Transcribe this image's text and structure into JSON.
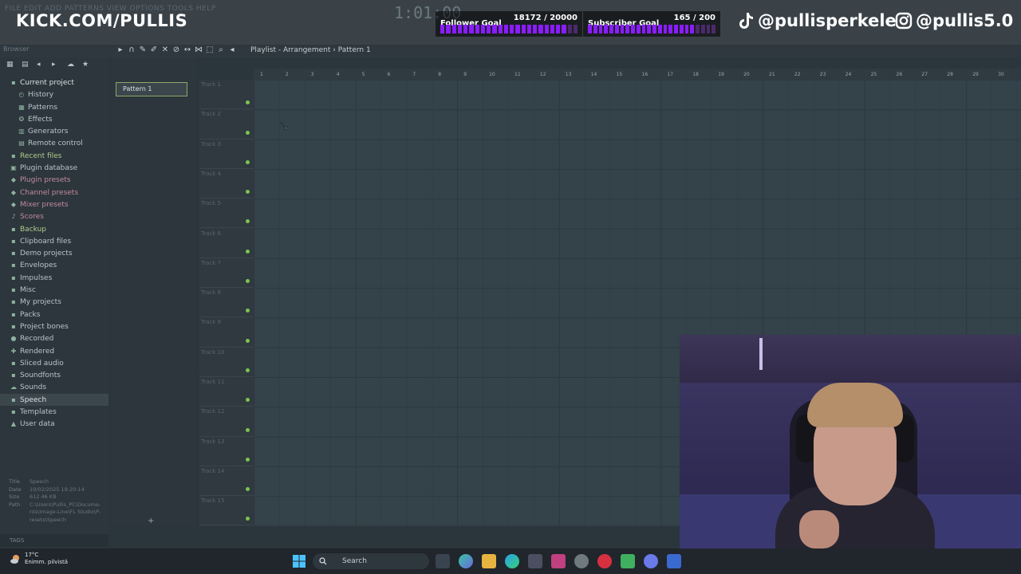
{
  "overlay": {
    "channel": "KICK.COM/PULLIS",
    "follower_goal": {
      "label": "Follower Goal",
      "value": "18172 / 20000",
      "progress": 0.9086
    },
    "subscriber_goal": {
      "label": "Subscriber Goal",
      "value": "165 / 200",
      "progress": 0.825
    },
    "tiktok_handle": "@pullisperkele",
    "instagram_handle": "@pullis5.0",
    "bar_color": "#8a1cff"
  },
  "app": {
    "background_menu": "FILE EDIT ADD PATTERNS VIEW OPTIONS TOOLS HELP",
    "background_time": "1:01:00",
    "browser_tab": "Browser",
    "playlist": {
      "title": "Playlist - Arrangement",
      "separator": "›",
      "pattern": "Pattern 1",
      "pattern_item": "Pattern 1",
      "ruler": [
        "1",
        "2",
        "3",
        "4",
        "5",
        "6",
        "7",
        "8",
        "9",
        "10",
        "11",
        "12",
        "13",
        "14",
        "15",
        "16",
        "17",
        "18",
        "19",
        "20",
        "21",
        "22",
        "23",
        "24",
        "25",
        "26",
        "27",
        "28",
        "29",
        "30"
      ],
      "tracks": [
        "Track 1",
        "Track 2",
        "Track 3",
        "Track 4",
        "Track 5",
        "Track 6",
        "Track 7",
        "Track 8",
        "Track 9",
        "Track 10",
        "Track 11",
        "Track 12",
        "Track 13",
        "Track 14",
        "Track 15"
      ]
    },
    "browser": {
      "items": [
        {
          "label": "Current project",
          "style": "hdr",
          "icon": "folder-icon",
          "indent": 0
        },
        {
          "label": "History",
          "style": "normal",
          "icon": "history-icon",
          "indent": 1
        },
        {
          "label": "Patterns",
          "style": "normal",
          "icon": "patterns-icon",
          "indent": 1
        },
        {
          "label": "Effects",
          "style": "normal",
          "icon": "effects-icon",
          "indent": 1
        },
        {
          "label": "Generators",
          "style": "normal",
          "icon": "generators-icon",
          "indent": 1
        },
        {
          "label": "Remote control",
          "style": "normal",
          "icon": "remote-icon",
          "indent": 1
        },
        {
          "label": "Recent files",
          "style": "green",
          "icon": "folder-icon",
          "indent": 0
        },
        {
          "label": "Plugin database",
          "style": "normal",
          "icon": "database-icon",
          "indent": 0
        },
        {
          "label": "Plugin presets",
          "style": "pink",
          "icon": "preset-icon",
          "indent": 0
        },
        {
          "label": "Channel presets",
          "style": "pink",
          "icon": "preset-icon",
          "indent": 0
        },
        {
          "label": "Mixer presets",
          "style": "pink",
          "icon": "preset-icon",
          "indent": 0
        },
        {
          "label": "Scores",
          "style": "pink",
          "icon": "score-icon",
          "indent": 0
        },
        {
          "label": "Backup",
          "style": "green",
          "icon": "folder-icon",
          "indent": 0
        },
        {
          "label": "Clipboard files",
          "style": "normal",
          "icon": "folder-icon",
          "indent": 0
        },
        {
          "label": "Demo projects",
          "style": "normal",
          "icon": "folder-icon",
          "indent": 0
        },
        {
          "label": "Envelopes",
          "style": "normal",
          "icon": "folder-icon",
          "indent": 0
        },
        {
          "label": "Impulses",
          "style": "normal",
          "icon": "folder-icon",
          "indent": 0
        },
        {
          "label": "Misc",
          "style": "normal",
          "icon": "folder-icon",
          "indent": 0
        },
        {
          "label": "My projects",
          "style": "normal",
          "icon": "folder-icon",
          "indent": 0
        },
        {
          "label": "Packs",
          "style": "normal",
          "icon": "folder-icon",
          "indent": 0
        },
        {
          "label": "Project bones",
          "style": "normal",
          "icon": "folder-icon",
          "indent": 0
        },
        {
          "label": "Recorded",
          "style": "normal",
          "icon": "recorded-icon",
          "indent": 0
        },
        {
          "label": "Rendered",
          "style": "normal",
          "icon": "rendered-icon",
          "indent": 0
        },
        {
          "label": "Sliced audio",
          "style": "normal",
          "icon": "folder-icon",
          "indent": 0
        },
        {
          "label": "Soundfonts",
          "style": "normal",
          "icon": "folder-icon",
          "indent": 0
        },
        {
          "label": "Sounds",
          "style": "normal",
          "icon": "cloud-icon",
          "indent": 0
        },
        {
          "label": "Speech",
          "style": "hdr",
          "icon": "folder-icon",
          "indent": 0,
          "selected": true
        },
        {
          "label": "Templates",
          "style": "normal",
          "icon": "folder-icon",
          "indent": 0
        },
        {
          "label": "User data",
          "style": "normal",
          "icon": "user-icon",
          "indent": 0
        }
      ],
      "fileinfo": {
        "title_k": "Title",
        "title_v": "Speech",
        "date_k": "Date",
        "date_v": "19/02/2025 19:20:14",
        "size_k": "Size",
        "size_v": "612.46 KB",
        "path_k": "Path",
        "path_v1": "C:\\Users\\Pullis_PC\\Docume-",
        "path_v2": "nts\\Image-Line\\FL Studio\\P-",
        "path_v3": "resets\\Speech"
      },
      "tags_label": "TAGS"
    }
  },
  "taskbar": {
    "weather_temp": "17°C",
    "weather_desc": "Enimm. pilvistä",
    "search_placeholder": "Search"
  }
}
